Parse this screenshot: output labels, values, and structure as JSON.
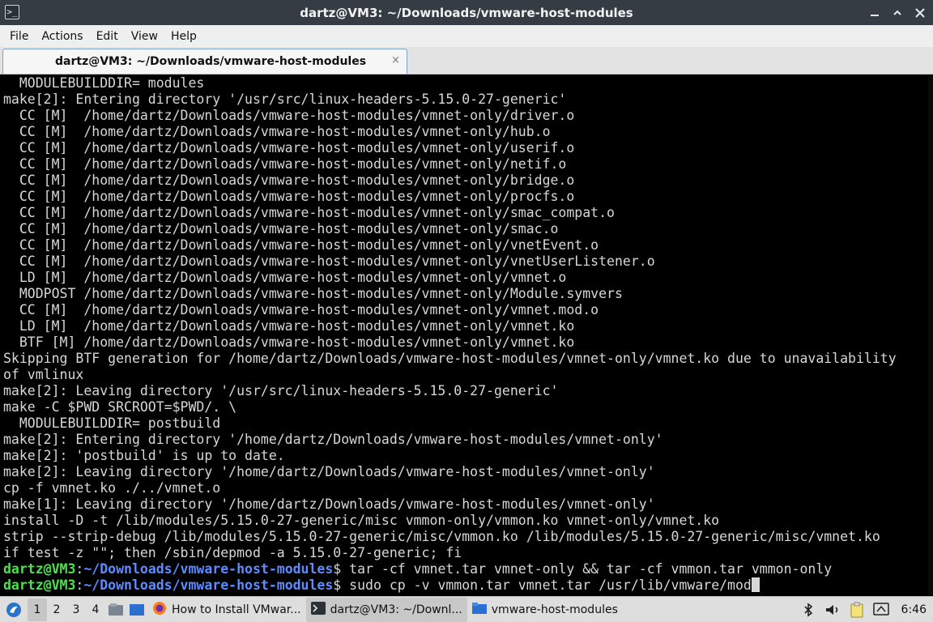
{
  "window": {
    "title": "dartz@VM3: ~/Downloads/vmware-host-modules",
    "icon": "terminal-icon"
  },
  "menubar": [
    "File",
    "Actions",
    "Edit",
    "View",
    "Help"
  ],
  "tab": {
    "label": "dartz@VM3: ~/Downloads/vmware-host-modules",
    "close": "×"
  },
  "terminal": {
    "lines": [
      "  MODULEBUILDDIR= modules",
      "make[2]: Entering directory '/usr/src/linux-headers-5.15.0-27-generic'",
      "  CC [M]  /home/dartz/Downloads/vmware-host-modules/vmnet-only/driver.o",
      "  CC [M]  /home/dartz/Downloads/vmware-host-modules/vmnet-only/hub.o",
      "  CC [M]  /home/dartz/Downloads/vmware-host-modules/vmnet-only/userif.o",
      "  CC [M]  /home/dartz/Downloads/vmware-host-modules/vmnet-only/netif.o",
      "  CC [M]  /home/dartz/Downloads/vmware-host-modules/vmnet-only/bridge.o",
      "  CC [M]  /home/dartz/Downloads/vmware-host-modules/vmnet-only/procfs.o",
      "  CC [M]  /home/dartz/Downloads/vmware-host-modules/vmnet-only/smac_compat.o",
      "  CC [M]  /home/dartz/Downloads/vmware-host-modules/vmnet-only/smac.o",
      "  CC [M]  /home/dartz/Downloads/vmware-host-modules/vmnet-only/vnetEvent.o",
      "  CC [M]  /home/dartz/Downloads/vmware-host-modules/vmnet-only/vnetUserListener.o",
      "  LD [M]  /home/dartz/Downloads/vmware-host-modules/vmnet-only/vmnet.o",
      "  MODPOST /home/dartz/Downloads/vmware-host-modules/vmnet-only/Module.symvers",
      "  CC [M]  /home/dartz/Downloads/vmware-host-modules/vmnet-only/vmnet.mod.o",
      "  LD [M]  /home/dartz/Downloads/vmware-host-modules/vmnet-only/vmnet.ko",
      "  BTF [M] /home/dartz/Downloads/vmware-host-modules/vmnet-only/vmnet.ko",
      "Skipping BTF generation for /home/dartz/Downloads/vmware-host-modules/vmnet-only/vmnet.ko due to unavailability",
      "of vmlinux",
      "make[2]: Leaving directory '/usr/src/linux-headers-5.15.0-27-generic'",
      "make -C $PWD SRCROOT=$PWD/. \\",
      "  MODULEBUILDDIR= postbuild",
      "make[2]: Entering directory '/home/dartz/Downloads/vmware-host-modules/vmnet-only'",
      "make[2]: 'postbuild' is up to date.",
      "make[2]: Leaving directory '/home/dartz/Downloads/vmware-host-modules/vmnet-only'",
      "cp -f vmnet.ko ./../vmnet.o",
      "make[1]: Leaving directory '/home/dartz/Downloads/vmware-host-modules/vmnet-only'",
      "install -D -t /lib/modules/5.15.0-27-generic/misc vmmon-only/vmmon.ko vmnet-only/vmnet.ko",
      "strip --strip-debug /lib/modules/5.15.0-27-generic/misc/vmmon.ko /lib/modules/5.15.0-27-generic/misc/vmnet.ko",
      "if test -z \"\"; then /sbin/depmod -a 5.15.0-27-generic; fi"
    ],
    "prompt_user": "dartz@VM3",
    "prompt_sep": ":",
    "prompt_path": "~/Downloads/vmware-host-modules",
    "prompt_end": "$ ",
    "cmd1": "tar -cf vmnet.tar vmnet-only && tar -cf vmmon.tar vmmon-only",
    "cmd2": "sudo cp -v vmmon.tar vmnet.tar /usr/lib/vmware/mod"
  },
  "taskbar": {
    "menu_icon": "start-menu-icon",
    "desktops": [
      "1",
      "2",
      "3",
      "4"
    ],
    "active_desktop": 0,
    "tasks": [
      {
        "label": "How to Install VMwar...",
        "icon": "firefox-icon"
      },
      {
        "label": "dartz@VM3: ~/Downl...",
        "icon": "terminal-icon"
      },
      {
        "label": "vmware-host-modules",
        "icon": "folder-icon"
      }
    ],
    "active_task": 1,
    "clock": "6:46"
  },
  "colors": {
    "titlebar": "#353c44",
    "terminal_bg": "#000000",
    "terminal_fg": "#d7d7d7",
    "prompt_user": "#4ee14e",
    "prompt_path": "#5c8cff"
  }
}
